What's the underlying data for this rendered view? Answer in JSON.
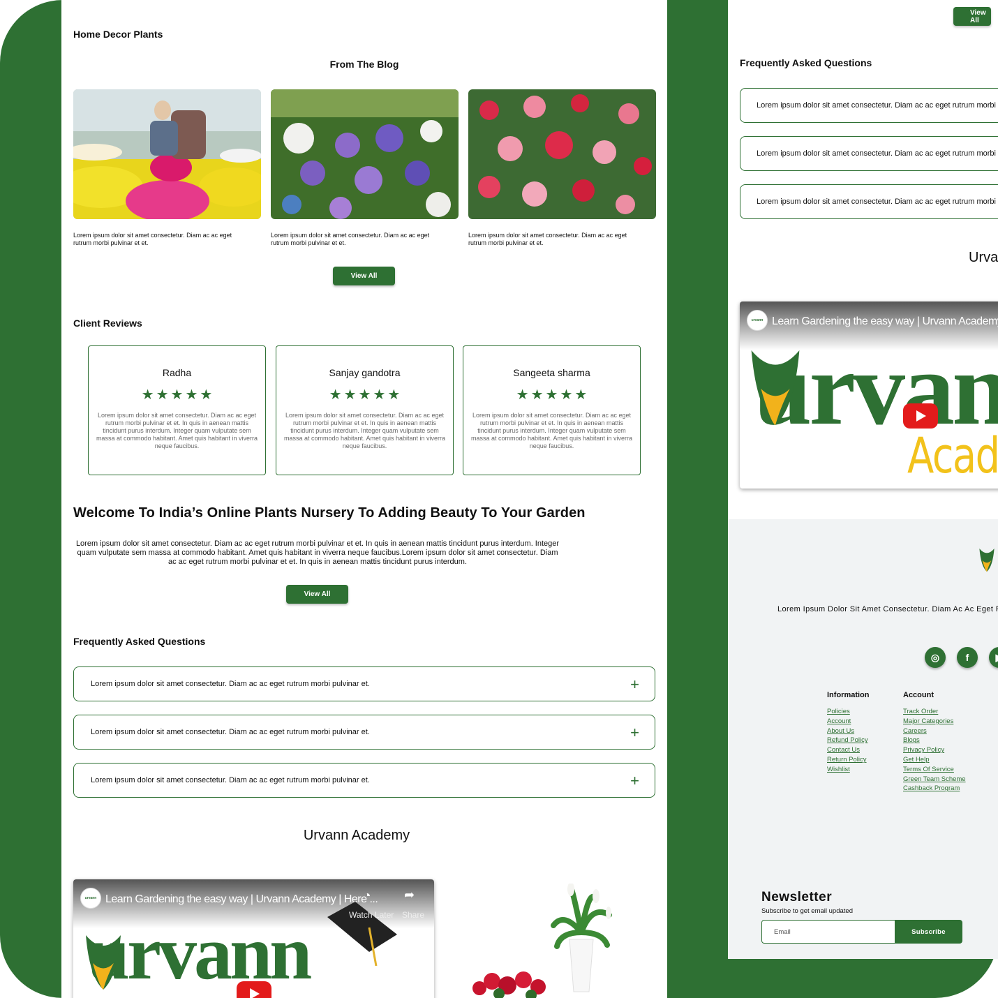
{
  "left": {
    "home_decor_title": "Home Decor Plants",
    "blog_title": "From The Blog",
    "blog_posts": [
      {
        "text": "Lorem ipsum dolor sit amet consectetur. Diam ac ac eget rutrum morbi pulvinar et et."
      },
      {
        "text": "Lorem ipsum dolor sit amet consectetur. Diam ac ac eget rutrum morbi pulvinar et et."
      },
      {
        "text": "Lorem ipsum dolor sit amet consectetur. Diam ac ac eget rutrum morbi pulvinar et et."
      }
    ],
    "blog_view_all": "View All",
    "reviews_title": "Client Reviews",
    "reviews": [
      {
        "name": "Radha",
        "rating": 5,
        "text": "Lorem ipsum dolor sit amet consectetur. Diam ac ac eget rutrum morbi pulvinar et et. In quis in aenean mattis tincidunt purus interdum. Integer quam vulputate sem massa at commodo habitant. Amet quis habitant in viverra neque faucibus."
      },
      {
        "name": "Sanjay gandotra",
        "rating": 5,
        "text": "Lorem ipsum dolor sit amet consectetur. Diam ac ac eget rutrum morbi pulvinar et et. In quis in aenean mattis tincidunt purus interdum. Integer quam vulputate sem massa at commodo habitant. Amet quis habitant in viverra neque faucibus."
      },
      {
        "name": "Sangeeta sharma",
        "rating": 5,
        "text": "Lorem ipsum dolor sit amet consectetur. Diam ac ac eget rutrum morbi pulvinar et et. In quis in aenean mattis tincidunt purus interdum. Integer quam vulputate sem massa at commodo habitant. Amet quis habitant in viverra neque faucibus."
      }
    ],
    "star_glyph": "★",
    "welcome_title": "Welcome To India’s Online Plants Nursery To Adding Beauty To Your Garden",
    "welcome_text": "Lorem ipsum dolor sit amet consectetur. Diam ac ac eget rutrum morbi pulvinar et et. In quis in aenean mattis tincidunt purus interdum. Integer quam vulputate sem massa at commodo habitant. Amet quis habitant in viverra neque faucibus.Lorem ipsum dolor sit amet consectetur. Diam ac ac eget rutrum morbi pulvinar et et. In quis in aenean mattis tincidunt purus interdum.",
    "welcome_view_all": "View All",
    "faq_title": "Frequently Asked Questions",
    "faqs": [
      "Lorem ipsum dolor sit amet consectetur. Diam ac ac eget rutrum morbi pulvinar et.",
      "Lorem ipsum dolor sit amet consectetur. Diam ac ac eget rutrum morbi pulvinar et.",
      "Lorem ipsum dolor sit amet consectetur. Diam ac ac eget rutrum morbi pulvinar et."
    ],
    "faq_plus": "+",
    "academy_title": "Urvann Academy",
    "video": {
      "logo_text": "urvann",
      "title": "Learn Gardening the easy way | Urvann Academy | Here ...",
      "watch_later": "Watch Later",
      "share": "Share",
      "brand_word": "urvann"
    }
  },
  "right": {
    "top_button": "View All",
    "faq_title": "Frequently Asked Questions",
    "faqs": [
      "Lorem ipsum dolor sit amet consectetur. Diam ac ac eget rutrum morbi pulvinar et.",
      "Lorem ipsum dolor sit amet consectetur. Diam ac ac eget rutrum morbi pulvinar et.",
      "Lorem ipsum dolor sit amet consectetur. Diam ac ac eget rutrum morbi pulvinar et."
    ],
    "academy_title": "Urvann Academy",
    "video": {
      "logo_text": "urvann",
      "title": "Learn Gardening the easy way | Urvann Academy | Here ...",
      "brand_word": "urvann",
      "brand_sub": "Academy"
    },
    "footer": {
      "tagline": "Lorem Ipsum Dolor Sit Amet Consectetur. Diam Ac Ac Eget Rutrum Morbi Pulvinar Et Et.",
      "social": [
        "instagram-icon",
        "facebook-icon",
        "youtube-icon"
      ],
      "information_title": "Information",
      "information_links": [
        "Policies",
        "Account",
        "About Us",
        "Refund Policy",
        "Contact Us",
        "Return Policy",
        "Wishlist"
      ],
      "account_title": "Account",
      "account_links": [
        "Track Order",
        "Major Categories",
        "Careers",
        "Blogs",
        "Privacy Policy",
        "Get Help",
        "Terms Of Service",
        "Green Team Scheme",
        "Cashback Program"
      ]
    },
    "newsletter": {
      "title": "Newsletter",
      "subtitle": "Subscribe to get email updated",
      "placeholder": "Email",
      "button": "Subscribe"
    }
  },
  "colors": {
    "brand_green": "#2e7033",
    "footer_grey": "#f1f3f4",
    "youtube_red": "#e31b1b",
    "academy_yellow": "#f2c21b"
  }
}
